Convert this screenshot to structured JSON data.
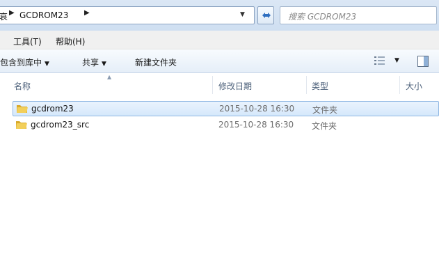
{
  "address": {
    "crumbs": [
      "GCDROM23"
    ],
    "partial_prefix": "哀"
  },
  "search": {
    "placeholder": "搜索 GCDROM23"
  },
  "menu": {
    "items": [
      "工具(T)",
      "帮助(H)"
    ]
  },
  "toolbar": {
    "include_library": "包含到库中",
    "share": "共享",
    "new_folder": "新建文件夹"
  },
  "columns": {
    "name": "名称",
    "modified": "修改日期",
    "type": "类型",
    "size": "大小"
  },
  "files": [
    {
      "name": "gcdrom23",
      "modified": "2015-10-28 16:30",
      "type": "文件夹",
      "selected": true
    },
    {
      "name": "gcdrom23_src",
      "modified": "2015-10-28 16:30",
      "type": "文件夹",
      "selected": false
    }
  ],
  "colors": {
    "selection": "#d5e8fb",
    "selection_border": "#8fb7e3",
    "header_text": "#4c607a",
    "folder": "#e8c14a"
  },
  "icons": [
    "refresh-icon",
    "views-icon",
    "preview-pane-icon",
    "folder-icon"
  ]
}
